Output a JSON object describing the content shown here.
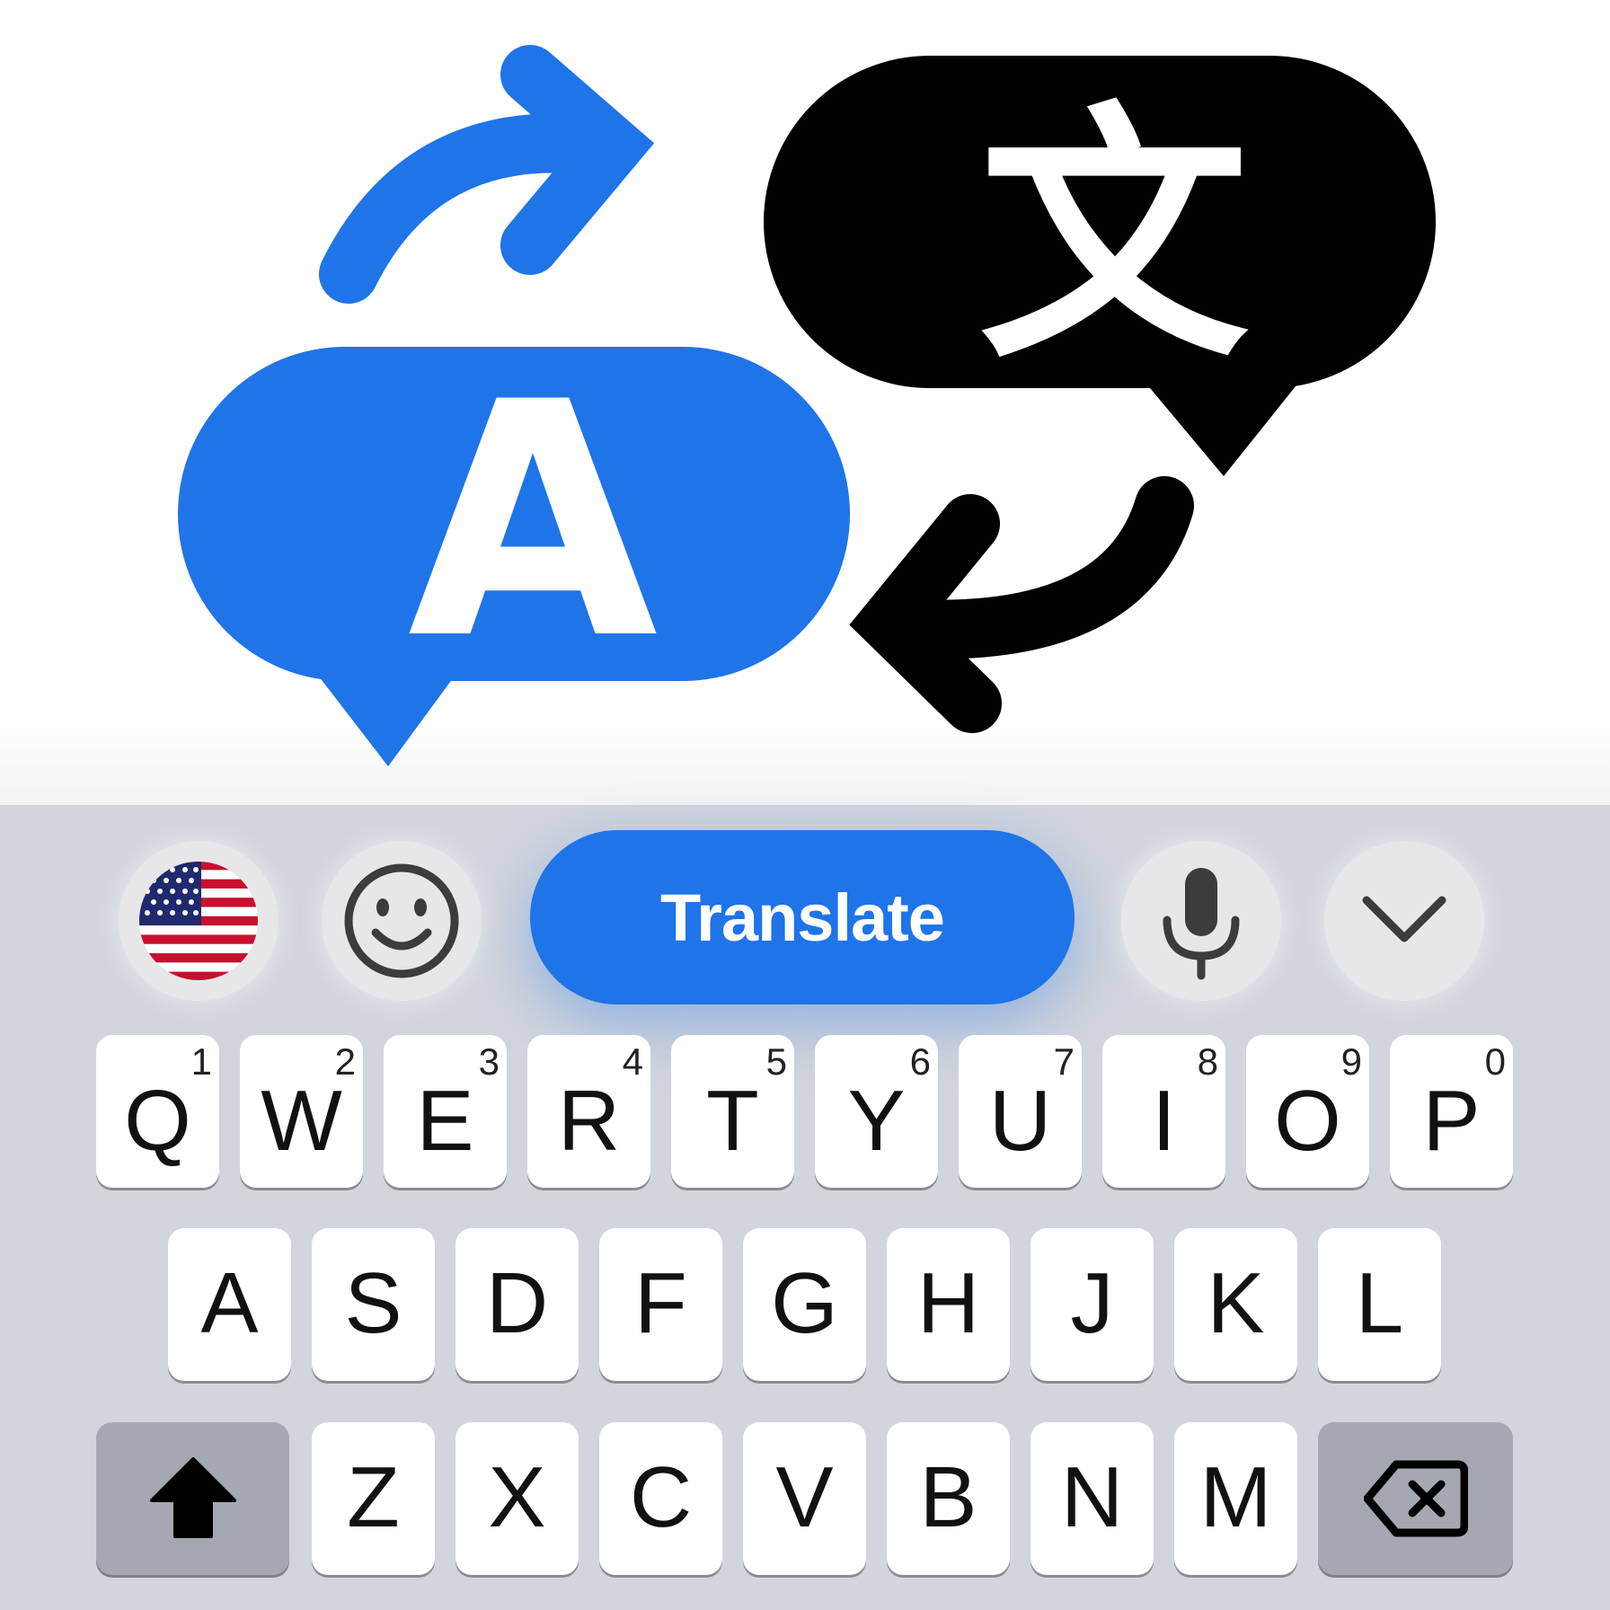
{
  "hero": {
    "source_bubble_glyph": "A",
    "target_bubble_glyph": "文",
    "colors": {
      "blue": "#1f74e8",
      "black": "#000000"
    }
  },
  "toolbar": {
    "language_icon": "us-flag-icon",
    "emoji_icon": "smiley-icon",
    "translate_label": "Translate",
    "mic_icon": "microphone-icon",
    "collapse_icon": "chevron-down-icon"
  },
  "keyboard": {
    "row1": [
      {
        "letter": "Q",
        "number": "1"
      },
      {
        "letter": "W",
        "number": "2"
      },
      {
        "letter": "E",
        "number": "3"
      },
      {
        "letter": "R",
        "number": "4"
      },
      {
        "letter": "T",
        "number": "5"
      },
      {
        "letter": "Y",
        "number": "6"
      },
      {
        "letter": "U",
        "number": "7"
      },
      {
        "letter": "I",
        "number": "8"
      },
      {
        "letter": "O",
        "number": "9"
      },
      {
        "letter": "P",
        "number": "0"
      }
    ],
    "row2": [
      "A",
      "S",
      "D",
      "F",
      "G",
      "H",
      "J",
      "K",
      "L"
    ],
    "row3": [
      "Z",
      "X",
      "C",
      "V",
      "B",
      "N",
      "M"
    ],
    "shift_icon": "shift-arrow-icon",
    "backspace_icon": "backspace-icon",
    "colors": {
      "background": "#d2d5dc",
      "key": "#ffffff",
      "function_key": "#a4a8b1"
    }
  }
}
